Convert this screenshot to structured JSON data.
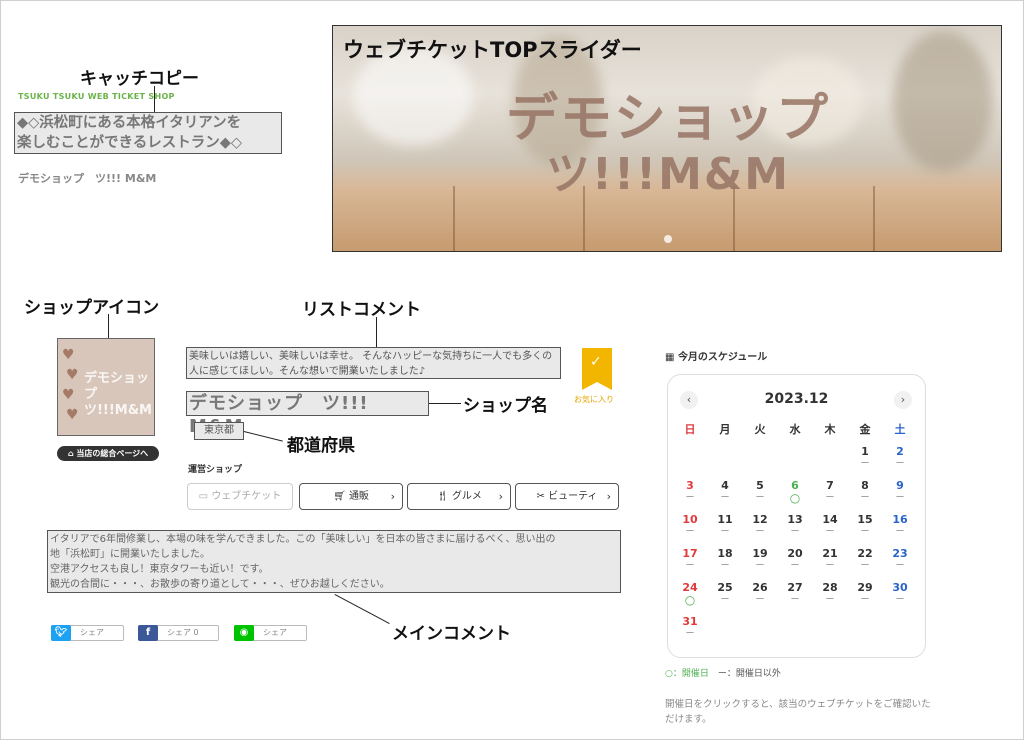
{
  "annotations": {
    "catch_copy": "キャッチコピー",
    "slider": "ウェブチケットTOPスライダー",
    "shop_icon": "ショップアイコン",
    "list_comment": "リストコメント",
    "shop_name": "ショップ名",
    "prefecture": "都道府県",
    "main_comment": "メインコメント"
  },
  "header": {
    "brand": "TSUKU TSUKU WEB TICKET SHOP",
    "catch_line1": "◆◇浜松町にある本格イタリアンを",
    "catch_line2": "楽しむことができるレストラン◆◇",
    "shop_name_small": "デモショップ　ツ!!! M&M"
  },
  "slider": {
    "title_line1": "デモショップ",
    "title_line2": "ツ!!!M&M"
  },
  "shop": {
    "icon_text_line1": "デモショップ",
    "icon_text_line2": "ツ!!!M&M",
    "toppage_button": "当店の総合ページへ",
    "list_comment": "美味しいは嬉しい、美味しいは幸せ。 そんなハッピーな気持ちに一人でも多くの人に感じてほしい。そんな想いで開業いたしました♪",
    "name": "デモショップ　ツ!!! M&M",
    "prefecture": "東京都",
    "bookmark_label": "お気に入り",
    "operator_label": "運営ショップ"
  },
  "categories": [
    {
      "label": "ウェブチケット",
      "icon": "ticket-icon",
      "active": true
    },
    {
      "label": "通販",
      "icon": "cart-icon",
      "active": false
    },
    {
      "label": "グルメ",
      "icon": "cutlery-icon",
      "active": false
    },
    {
      "label": "ビューティ",
      "icon": "scissors-icon",
      "active": false
    }
  ],
  "main_comment": {
    "line1": "イタリアで6年間修業し、本場の味を学んできました。この「美味しい」を日本の皆さまに届けるべく、思い出の",
    "line2": "地「浜松町」に開業いたしました。",
    "line3": "空港アクセスも良し！東京タワーも近い！です。",
    "line4": "観光の合間に・・・、お散歩の寄り道として・・・、ぜひお越しください。"
  },
  "share": {
    "twitter": "シェア",
    "facebook": "シェア 0",
    "line": "シェア"
  },
  "schedule": {
    "title": "今月のスケジュール",
    "month": "2023.12",
    "prev": "‹",
    "next": "›",
    "weekdays": [
      "日",
      "月",
      "火",
      "水",
      "木",
      "金",
      "土"
    ],
    "open_days": [
      6,
      24
    ],
    "closed_mark": "ー",
    "open_mark": "○",
    "legend_open": "○：開催日",
    "legend_closed": "ー：開催日以外",
    "note": "開催日をクリックすると、該当のウェブチケットをご確認いただけます。",
    "colors": {
      "sunday": "#e03a3a",
      "saturday": "#2a63c9",
      "open": "#4caf50"
    }
  }
}
